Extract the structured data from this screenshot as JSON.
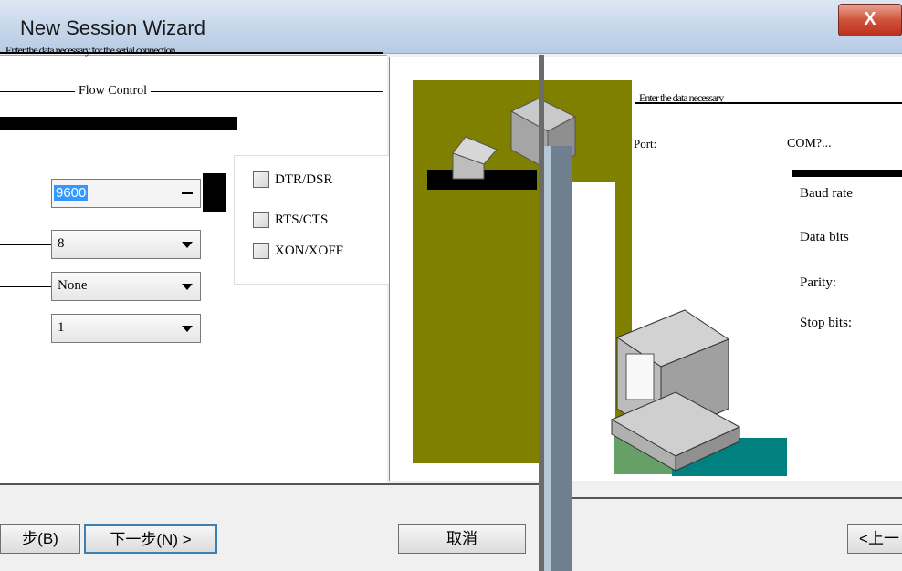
{
  "window": {
    "title": "New Session Wizard",
    "close_label": "X"
  },
  "left": {
    "header_text": "Enter the data necessary for the serial connection",
    "flow_label": "Flow Control",
    "baud_value": "9600",
    "data_bits_value": "8",
    "parity_value": "None",
    "stop_bits_value": "1",
    "flow_options": [
      {
        "label": "DTR/DSR"
      },
      {
        "label": "RTS/CTS"
      },
      {
        "label": "XON/XOFF"
      }
    ],
    "buttons": {
      "back": "步(B)",
      "next": "下一步(N) >",
      "cancel": "取消"
    }
  },
  "right": {
    "header_text": "Enter the data necessary",
    "port_label": "Port:",
    "port_value": "COM?...",
    "labels": [
      "Baud rate",
      "Data bits",
      "Parity:",
      "Stop bits:"
    ],
    "buttons": {
      "back": "<上一"
    }
  }
}
